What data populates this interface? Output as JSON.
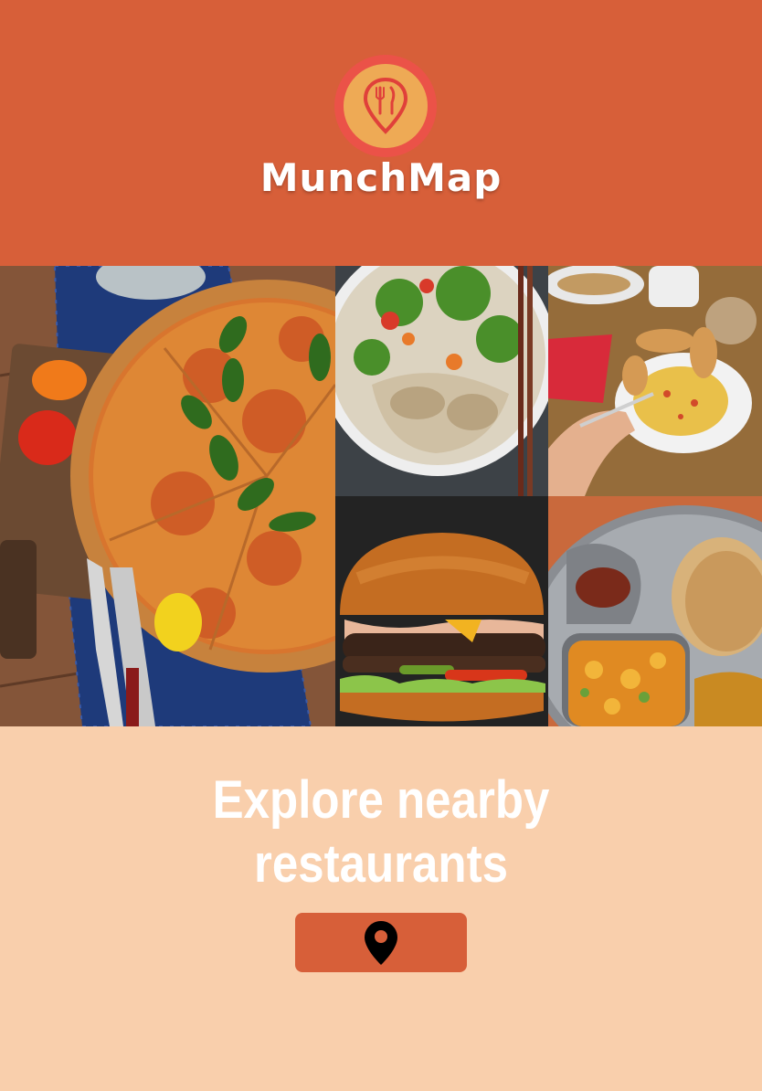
{
  "app": {
    "name": "MunchMap",
    "logo_icon": "map-pin-cutlery-icon"
  },
  "colors": {
    "header_bg": "#D75F39",
    "logo_ring": "#EB5248",
    "logo_fill": "#EEAA55",
    "bottom_bg": "#F9CFAC",
    "button_bg": "#D75F39"
  },
  "photos": [
    {
      "name": "pizza-photo"
    },
    {
      "name": "noodle-salad-bowl-photo"
    },
    {
      "name": "scrambled-eggs-breakfast-photo"
    },
    {
      "name": "burger-photo"
    },
    {
      "name": "thali-platter-photo"
    }
  ],
  "hero": {
    "headline_line1": "Explore nearby",
    "headline_line2": "restaurants"
  },
  "locate_button": {
    "icon": "map-pin-icon"
  }
}
